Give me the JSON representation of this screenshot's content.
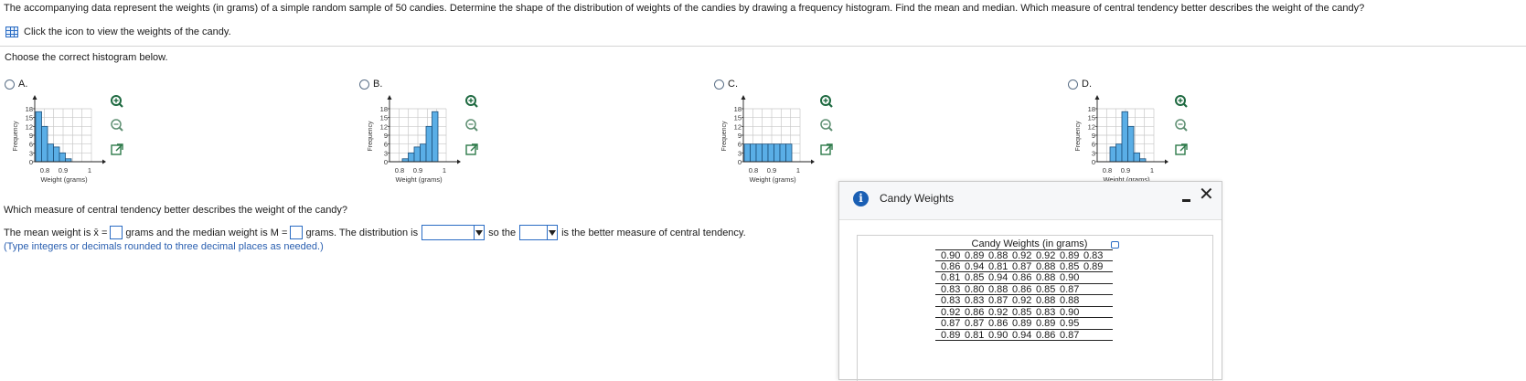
{
  "question_text": "The accompanying data represent the weights (in grams) of a simple random sample of 50 candies. Determine the shape of the distribution of weights of the candies by drawing a frequency histogram. Find the mean and median. Which measure of central tendency better describes the weight of the candy?",
  "data_link_label": "Click the icon to view the weights of the candy.",
  "instruction": "Choose the correct histogram below.",
  "options": [
    {
      "letter": "A.",
      "counts": [
        17,
        12,
        6,
        5,
        3,
        1,
        0,
        0
      ]
    },
    {
      "letter": "B.",
      "counts": [
        0,
        0,
        1,
        3,
        5,
        6,
        12,
        17
      ]
    },
    {
      "letter": "C.",
      "counts": [
        6,
        6,
        6,
        6,
        6,
        6,
        6,
        6
      ]
    },
    {
      "letter": "D.",
      "counts": [
        0,
        0,
        5,
        6,
        17,
        12,
        3,
        1
      ]
    }
  ],
  "chart_axes": {
    "ylabel": "Frequency",
    "xlabel": "Weight (grams)",
    "yticks": [
      "18",
      "15",
      "12",
      "9",
      "6",
      "3",
      "0"
    ],
    "xticks": [
      "0.8",
      "0.9",
      "1"
    ]
  },
  "chart_data": [
    {
      "type": "bar",
      "title": "A",
      "categories": [
        "0.78",
        "0.80",
        "0.82",
        "0.84",
        "0.86",
        "0.88",
        "0.90",
        "0.92"
      ],
      "values": [
        17,
        12,
        6,
        5,
        3,
        1,
        0,
        0
      ],
      "xlabel": "Weight (grams)",
      "ylabel": "Frequency",
      "ylim": [
        0,
        18
      ]
    },
    {
      "type": "bar",
      "title": "B",
      "categories": [
        "0.78",
        "0.80",
        "0.82",
        "0.84",
        "0.86",
        "0.88",
        "0.90",
        "0.92"
      ],
      "values": [
        0,
        0,
        1,
        3,
        5,
        6,
        12,
        17
      ],
      "xlabel": "Weight (grams)",
      "ylabel": "Frequency",
      "ylim": [
        0,
        18
      ]
    },
    {
      "type": "bar",
      "title": "C",
      "categories": [
        "0.78",
        "0.80",
        "0.82",
        "0.84",
        "0.86",
        "0.88",
        "0.90",
        "0.92"
      ],
      "values": [
        6,
        6,
        6,
        6,
        6,
        6,
        6,
        6
      ],
      "xlabel": "Weight (grams)",
      "ylabel": "Frequency",
      "ylim": [
        0,
        18
      ]
    },
    {
      "type": "bar",
      "title": "D",
      "categories": [
        "0.78",
        "0.80",
        "0.82",
        "0.84",
        "0.86",
        "0.88",
        "0.90",
        "0.92"
      ],
      "values": [
        0,
        0,
        5,
        6,
        17,
        12,
        3,
        1
      ],
      "xlabel": "Weight (grams)",
      "ylabel": "Frequency",
      "ylim": [
        0,
        18
      ]
    }
  ],
  "question2": "Which measure of central tendency better describes the weight of the candy?",
  "answer": {
    "part1": "The mean weight is x̄ =",
    "part2": "grams and the median weight is M =",
    "part3": "grams. The distribution is",
    "part4": "so the",
    "part5": "is the better measure of central tendency."
  },
  "hint": "(Type integers or decimals rounded to three decimal places as needed.)",
  "popup": {
    "title": "Candy Weights",
    "table_caption": "Candy Weights (in grams)",
    "rows": [
      [
        "0.90",
        "0.89",
        "0.88",
        "0.92",
        "0.92",
        "0.89",
        "0.83"
      ],
      [
        "0.86",
        "0.94",
        "0.81",
        "0.87",
        "0.88",
        "0.85",
        "0.89"
      ],
      [
        "0.81",
        "0.85",
        "0.94",
        "0.86",
        "0.88",
        "0.90"
      ],
      [
        "0.83",
        "0.80",
        "0.88",
        "0.86",
        "0.85",
        "0.87"
      ],
      [
        "0.83",
        "0.83",
        "0.87",
        "0.92",
        "0.88",
        "0.88"
      ],
      [
        "0.92",
        "0.86",
        "0.92",
        "0.85",
        "0.83",
        "0.90"
      ],
      [
        "0.87",
        "0.87",
        "0.86",
        "0.89",
        "0.89",
        "0.95"
      ],
      [
        "0.89",
        "0.81",
        "0.90",
        "0.94",
        "0.86",
        "0.87"
      ]
    ]
  },
  "colors": {
    "bar_fill": "#5aaee6",
    "bar_stroke": "#1c4f7a",
    "accent": "#2a6cc4"
  }
}
